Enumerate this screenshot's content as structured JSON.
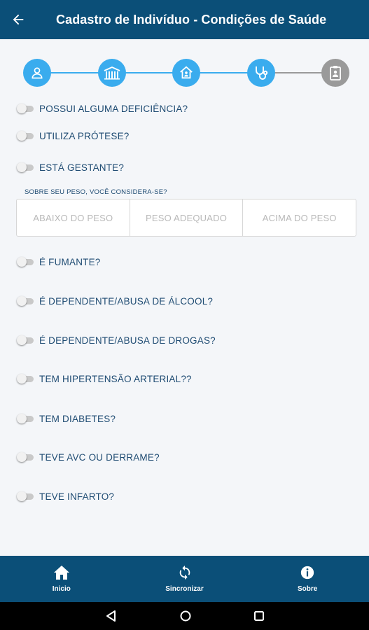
{
  "header": {
    "title": "Cadastro de Indivíduo - Condições de Saúde",
    "back_icon": "arrow-left-icon"
  },
  "stepper": {
    "steps": [
      {
        "icon": "person-icon",
        "state": "active"
      },
      {
        "icon": "building-icon",
        "state": "active"
      },
      {
        "icon": "house-icon",
        "state": "active"
      },
      {
        "icon": "stethoscope-icon",
        "state": "active"
      },
      {
        "icon": "id-badge-icon",
        "state": "inactive"
      }
    ],
    "active_color": "#3aacee",
    "inactive_color": "#9a9a9a"
  },
  "questions": {
    "deficiencia": "POSSUI ALGUMA DEFICIÊNCIA?",
    "protese": "UTILIZA PRÓTESE?",
    "gestante": "ESTÁ GESTANTE?",
    "fumante": "É FUMANTE?",
    "alcool": "É DEPENDENTE/ABUSA DE ÁLCOOL?",
    "drogas": "É DEPENDENTE/ABUSA DE DROGAS?",
    "hipertensao": "TEM HIPERTENSÃO ARTERIAL??",
    "diabetes": "TEM DIABETES?",
    "avc": "TEVE AVC OU DERRAME?",
    "infarto": "TEVE INFARTO?"
  },
  "weight": {
    "label": "SOBRE SEU PESO, VOCÊ CONSIDERA-SE?",
    "options": [
      "ABAIXO DO PESO",
      "PESO ADEQUADO",
      "ACIMA DO PESO"
    ]
  },
  "bottom_nav": {
    "home": "Inicio",
    "sync": "Sincronizar",
    "about": "Sobre"
  },
  "colors": {
    "primary": "#0b4f78",
    "accent": "#3aacee",
    "text": "#1e4b72"
  }
}
